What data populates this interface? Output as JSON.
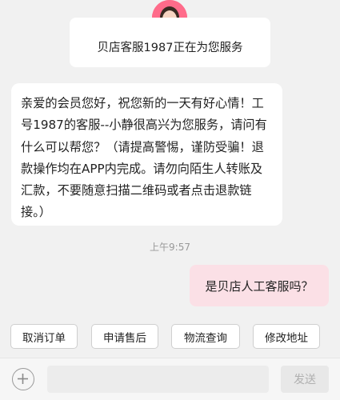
{
  "agent": {
    "avatar_icon": "agent-avatar",
    "status_text": "贝店客服1987正在为您服务"
  },
  "messages": {
    "incoming_text": "亲爱的会员您好，祝您新的一天有好心情！工号1987的客服--小静很高兴为您服务，请问有什么可以帮您？（请提高警惕，谨防受骗！退款操作均在APP内完成。请勿向陌生人转账及汇款，不要随意扫描二维码或者点击退款链接。）",
    "timestamp": "上午9:57",
    "outgoing_text": "是贝店人工客服吗？"
  },
  "quick_replies": [
    "取消订单",
    "申请售后",
    "物流查询",
    "修改地址"
  ],
  "input_bar": {
    "plus_icon": "plus-icon",
    "input_value": "",
    "input_placeholder": "",
    "send_label": "发送"
  },
  "colors": {
    "background": "#f1f1f1",
    "outgoing_bubble": "#fbe0e6",
    "avatar_bg": "#ff6b8a",
    "send_disabled_text": "#b0b0b0"
  }
}
